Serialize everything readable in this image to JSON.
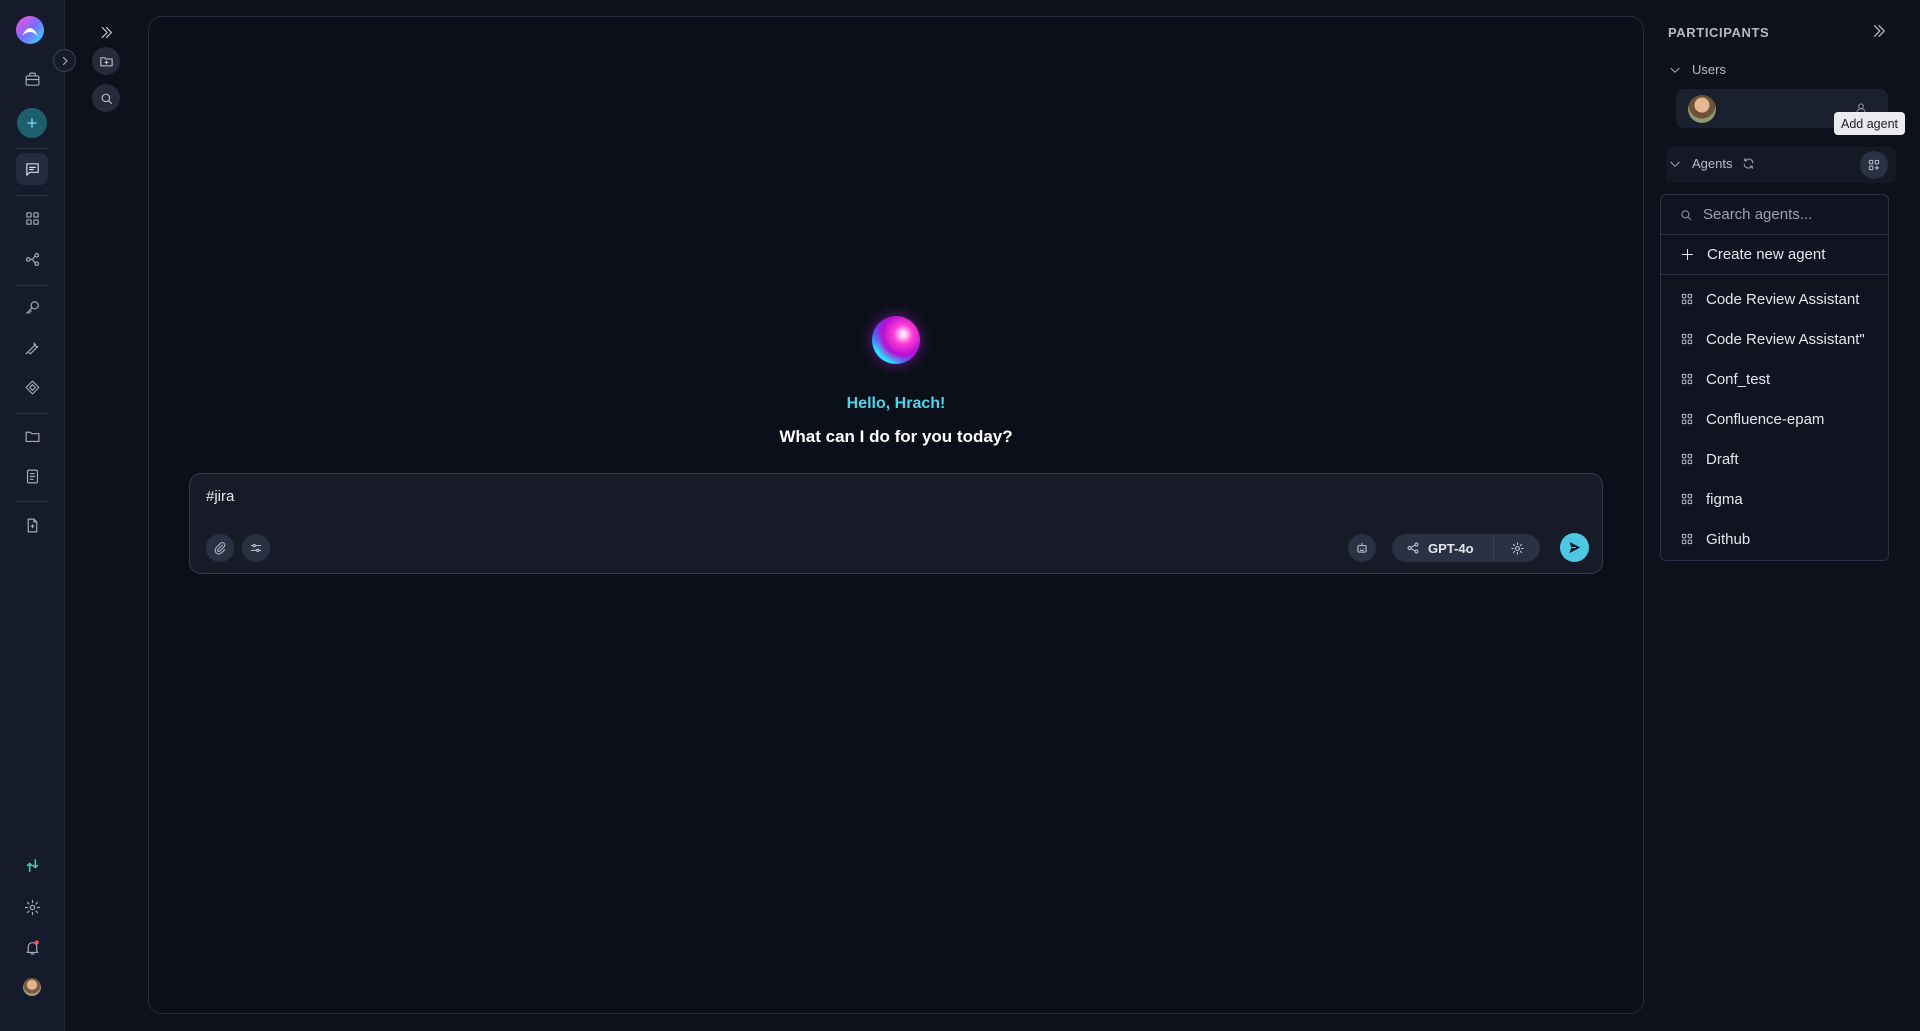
{
  "chat": {
    "greeting": "Hello, Hrach!",
    "subgreeting": "What can I do for you today?",
    "input_value": "#jira",
    "model_name": "GPT-4o"
  },
  "participants": {
    "title": "PARTICIPANTS",
    "users_label": "Users",
    "agents_label": "Agents",
    "tooltip": "Add agent",
    "search_placeholder": "Search agents...",
    "create_label": "Create new agent",
    "agents": [
      {
        "label": "Code Review Assistant"
      },
      {
        "label": "Code Review Assistant\""
      },
      {
        "label": "Conf_test"
      },
      {
        "label": "Confluence-epam"
      },
      {
        "label": "Draft"
      },
      {
        "label": "figma"
      },
      {
        "label": "Github"
      }
    ]
  },
  "colors": {
    "background": "#0d111c",
    "rail": "#161b2b",
    "accent": "#4fd4ec",
    "send_button": "#4cc8e2",
    "add_button": "#1e5f6e"
  },
  "icons": {
    "rail": [
      "logo-icon",
      "briefcase-icon",
      "plus-icon",
      "chat-icon",
      "grid-icon",
      "workflow-icon",
      "key-icon",
      "wrench-icon",
      "tag-icon",
      "folder-icon",
      "book-icon",
      "file-icon",
      "analytics-icon",
      "gear-icon",
      "bell-icon",
      "avatar"
    ],
    "composer": [
      "paperclip-icon",
      "sliders-icon",
      "robot-icon",
      "share-nodes-icon",
      "gear-icon",
      "send-icon"
    ]
  }
}
